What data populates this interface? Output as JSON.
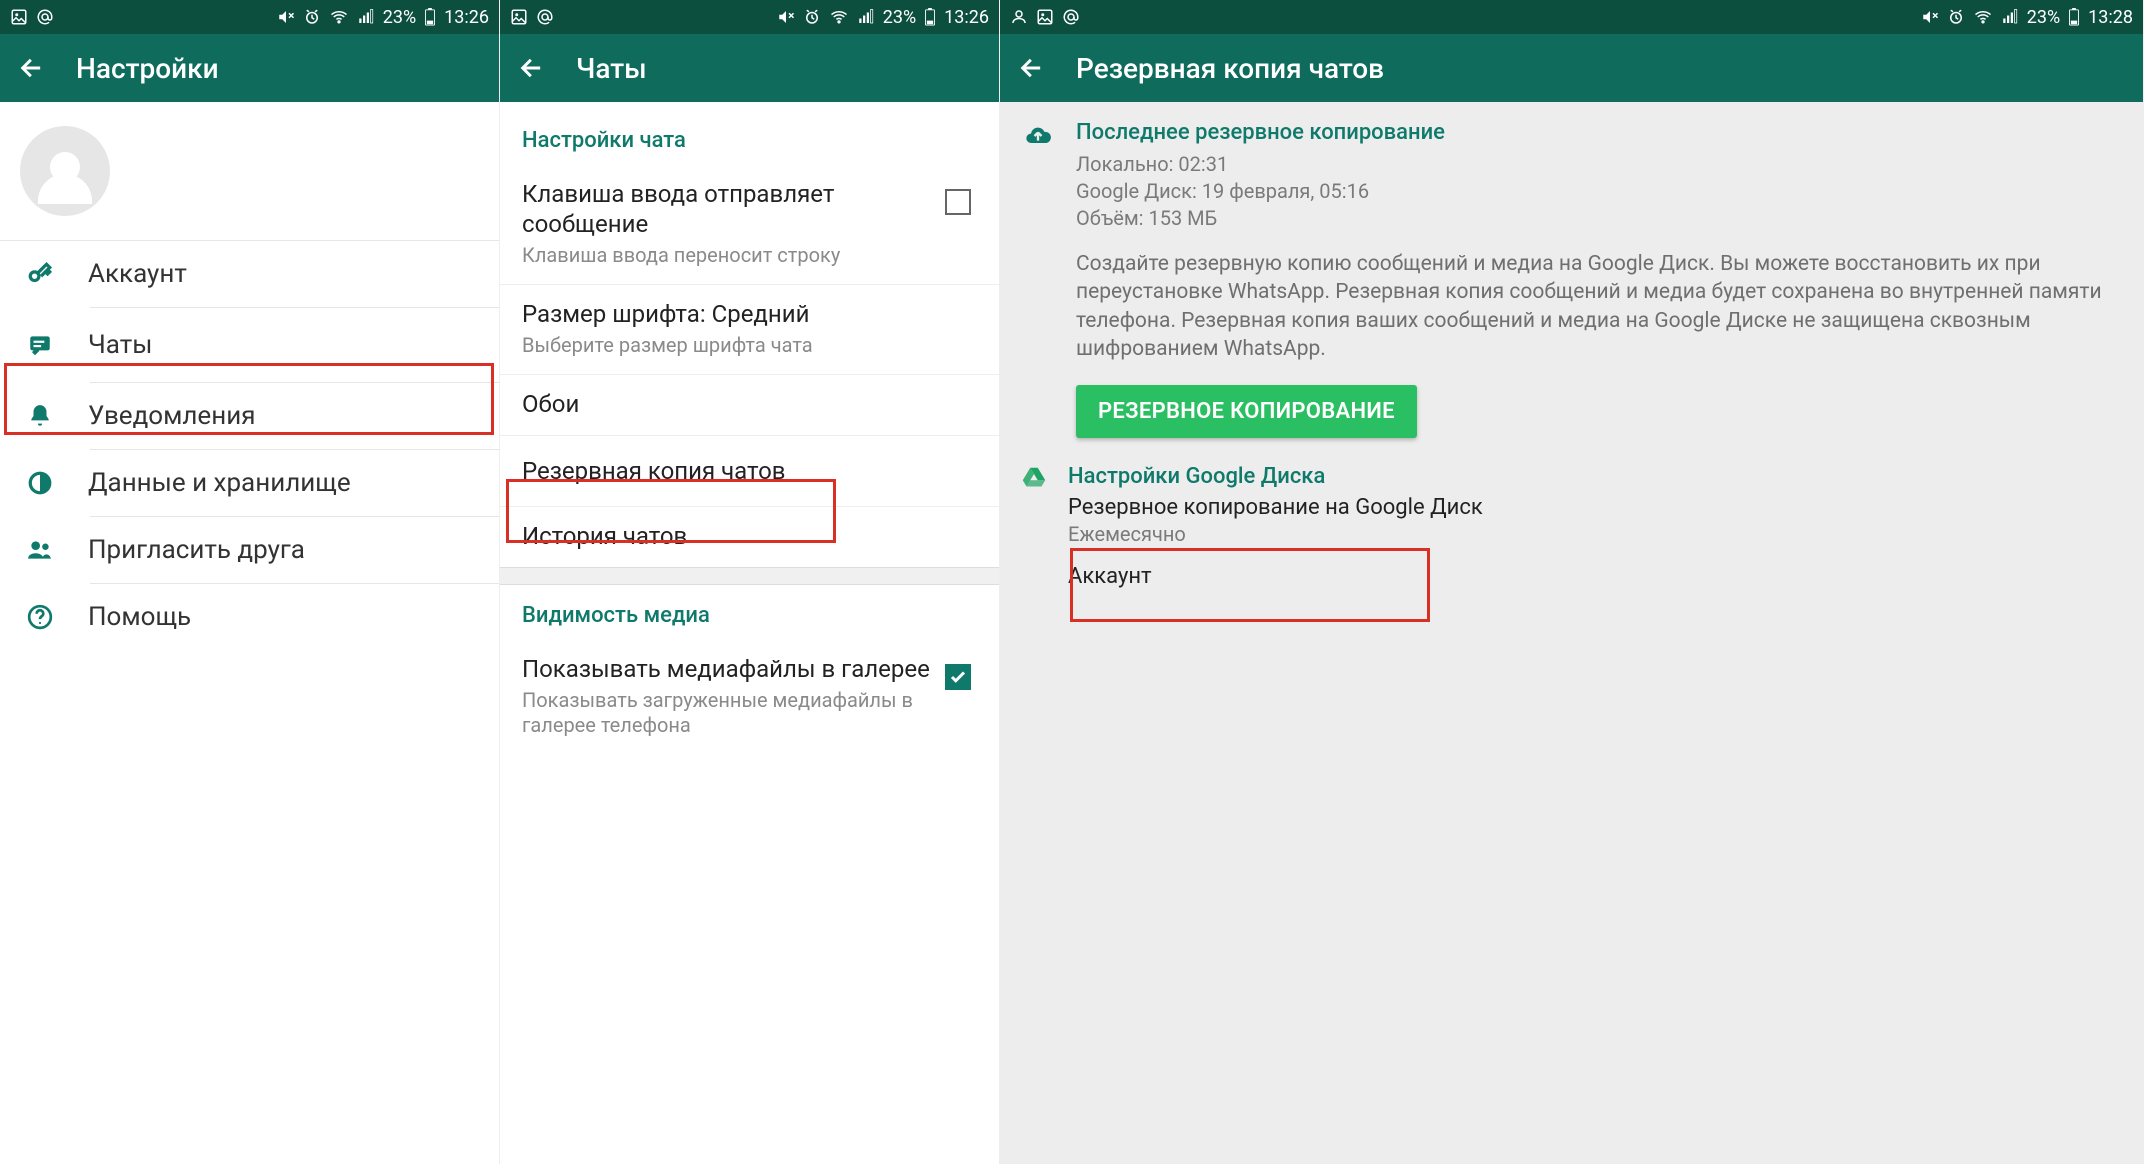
{
  "statusbar": {
    "battery_pct": "23%",
    "time_a": "13:26",
    "time_b": "13:26",
    "time_c": "13:28"
  },
  "screen1": {
    "title": "Настройки",
    "items": [
      {
        "label": "Аккаунт",
        "icon": "key"
      },
      {
        "label": "Чаты",
        "icon": "chat"
      },
      {
        "label": "Уведомления",
        "icon": "bell"
      },
      {
        "label": "Данные и хранилище",
        "icon": "data"
      },
      {
        "label": "Пригласить друга",
        "icon": "people"
      },
      {
        "label": "Помощь",
        "icon": "help"
      }
    ]
  },
  "screen2": {
    "title": "Чаты",
    "section1": "Настройки чата",
    "enter_send_title": "Клавиша ввода отправляет сообщение",
    "enter_send_sub": "Клавиша ввода переносит строку",
    "font_title": "Размер шрифта: Средний",
    "font_sub": "Выберите размер шрифта чата",
    "wallpaper": "Обои",
    "backup": "Резервная копия чатов",
    "history": "История чатов",
    "section2": "Видимость медиа",
    "media_title": "Показывать медиафайлы в галерее",
    "media_sub": "Показывать загруженные медиафайлы в галерее телефона"
  },
  "screen3": {
    "title": "Резервная копия чатов",
    "last_backup_heading": "Последнее резервное копирование",
    "local_line": "Локально: 02:31",
    "gdrive_line": "Google Диск: 19 февраля, 05:16",
    "size_line": "Объём: 153 МБ",
    "description": "Создайте резервную копию сообщений и медиа на Google Диск. Вы можете восстановить их при переустановке WhatsApp. Резервная копия сообщений и медиа будет сохранена во внутренней памяти телефона. Резервная копия ваших сообщений и медиа на Google Диске не защищена сквозным шифрованием WhatsApp.",
    "button": "РЕЗЕРВНОЕ КОПИРОВАНИЕ",
    "gdrive_settings": "Настройки Google Диска",
    "backup_to_title": "Резервное копирование на Google Диск",
    "backup_to_sub": "Ежемесячно",
    "account_label": "Аккаунт"
  }
}
